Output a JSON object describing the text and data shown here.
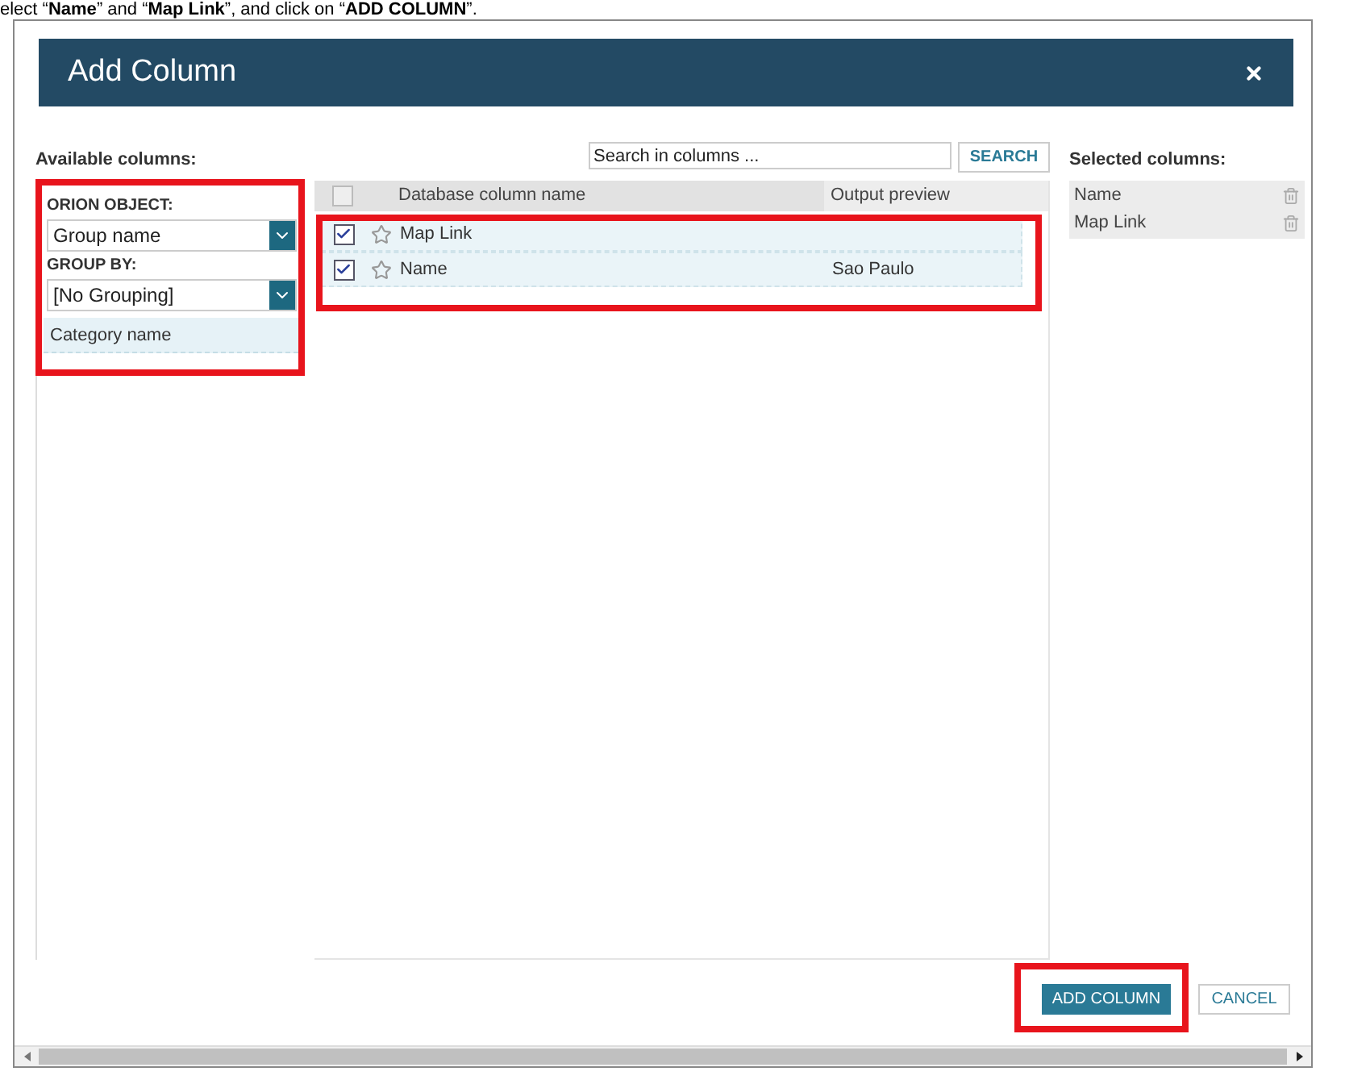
{
  "instruction": "elect “**Name**” and “**Map Link**”, and click on “**ADD COLUMN**”.",
  "dialog": {
    "title": "Add Column"
  },
  "available_label": "Available columns:",
  "orion_object": {
    "label": "ORION OBJECT:",
    "value": "Group name"
  },
  "group_by": {
    "label": "GROUP BY:",
    "value": "[No Grouping]"
  },
  "categories": [
    {
      "label": "Category name",
      "selected": true
    }
  ],
  "search": {
    "placeholder": "Search in columns ...",
    "button": "SEARCH"
  },
  "table": {
    "columns": [
      "Database column name",
      "Output preview"
    ],
    "header_checked": false,
    "rows": [
      {
        "name": "Map Link",
        "checked": true,
        "favorite": false
      },
      {
        "name": "Name",
        "preview": "Sao Paulo",
        "checked": true,
        "favorite": false
      }
    ]
  },
  "selected_columns": {
    "label": "Selected columns:",
    "items": [
      "Name",
      "Map Link"
    ]
  },
  "buttons": [
    {
      "label": "ADD COLUMN",
      "kind": "primary"
    },
    {
      "label": "CANCEL",
      "kind": "secondary"
    }
  ]
}
